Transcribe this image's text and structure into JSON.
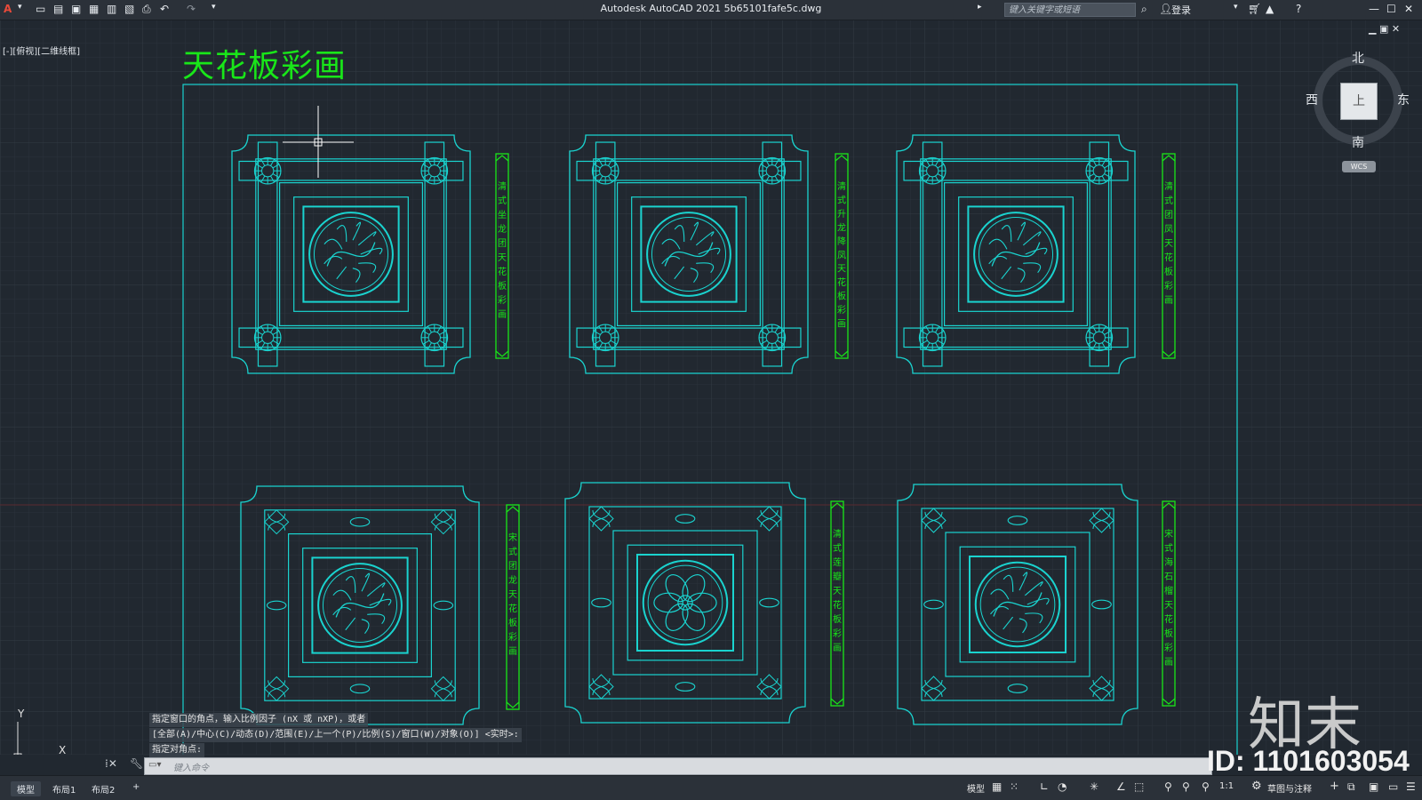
{
  "app": {
    "title": "Autodesk AutoCAD 2021    5b65101fafe5c.dwg",
    "search_placeholder": "键入关键字或短语",
    "login_label": "登录"
  },
  "viewport": {
    "label": "[-][俯视][二维线框]",
    "drawing_title": "天花板彩画"
  },
  "panels": [
    {
      "caption": "清式坐龙团天花板彩画",
      "style": "qing"
    },
    {
      "caption": "清式升龙降凤天花板彩画",
      "style": "qing"
    },
    {
      "caption": "清式团凤天花板彩画",
      "style": "qing"
    },
    {
      "caption": "宋式团龙天花板彩画",
      "style": "song"
    },
    {
      "caption": "清式莲瓣天花板彩画",
      "style": "lotus"
    },
    {
      "caption": "宋式海石榴天花板彩画",
      "style": "song"
    }
  ],
  "viewcube": {
    "north": "北",
    "south": "南",
    "east": "东",
    "west": "西",
    "top_face": "上",
    "wcs": "WCS"
  },
  "ucs": {
    "x": "X",
    "y": "Y"
  },
  "command": {
    "history": [
      "指定窗口的角点，输入比例因子 (nX 或 nXP)，或者",
      "[全部(A)/中心(C)/动态(D)/范围(E)/上一个(P)/比例(S)/窗口(W)/对象(O)] <实时>:",
      "指定对角点:"
    ],
    "placeholder": "键入命令"
  },
  "layout_tabs": [
    "模型",
    "布局1",
    "布局2"
  ],
  "status": {
    "model": "模型",
    "scale": "1:1",
    "workspace": "草图与注释"
  },
  "watermark": {
    "logo": "知末",
    "id": "ID: 1101603054"
  },
  "colors": {
    "background": "#212830",
    "cad_cyan": "#1ad3cf",
    "label_green": "#19e619"
  }
}
